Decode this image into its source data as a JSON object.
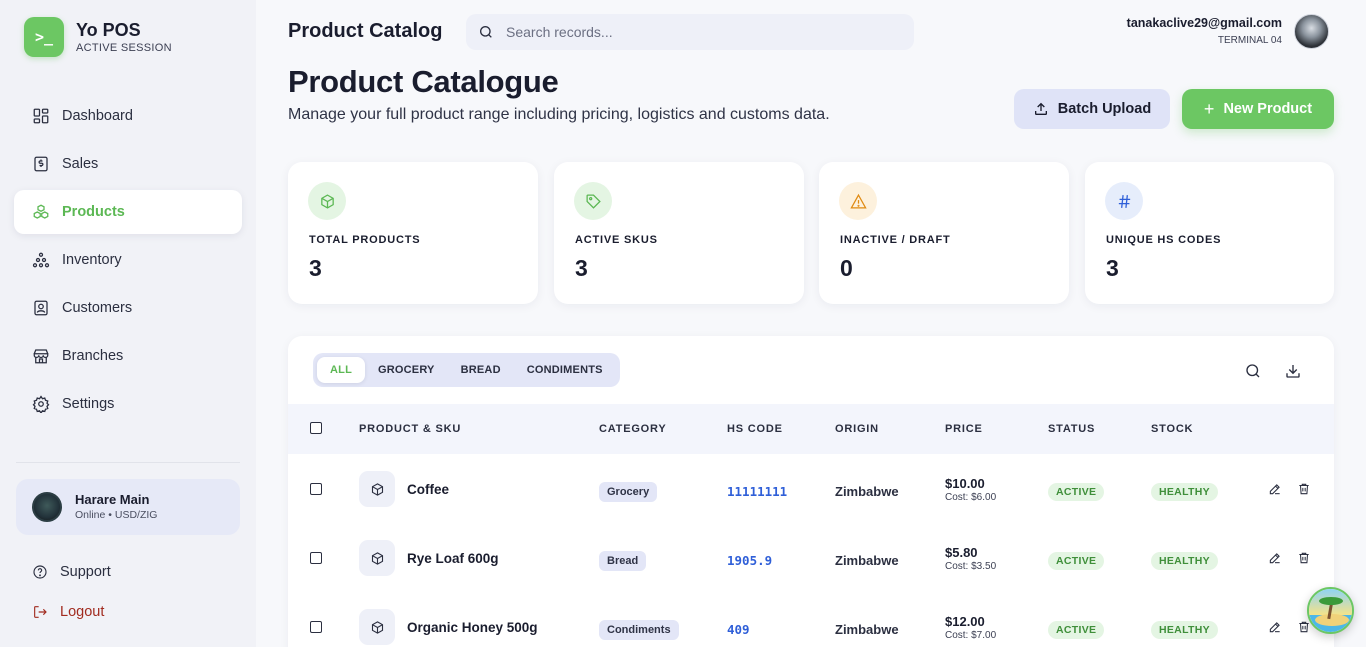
{
  "brand": {
    "logo_glyph": ">_",
    "name": "Yo POS",
    "subtitle": "ACTIVE SESSION"
  },
  "sidebar": {
    "items": [
      {
        "label": "Dashboard",
        "icon": "dashboard-icon",
        "active": false
      },
      {
        "label": "Sales",
        "icon": "receipt-icon",
        "active": false
      },
      {
        "label": "Products",
        "icon": "boxes-icon",
        "active": true
      },
      {
        "label": "Inventory",
        "icon": "inventory-icon",
        "active": false
      },
      {
        "label": "Customers",
        "icon": "contact-card-icon",
        "active": false
      },
      {
        "label": "Branches",
        "icon": "store-icon",
        "active": false
      },
      {
        "label": "Settings",
        "icon": "gear-icon",
        "active": false
      }
    ],
    "branch": {
      "name": "Harare Main",
      "status": "Online • USD/ZIG"
    },
    "support_label": "Support",
    "logout_label": "Logout"
  },
  "header": {
    "title": "Product Catalog",
    "search_placeholder": "Search records...",
    "user_email": "tanakaclive29@gmail.com",
    "terminal": "TERMINAL 04"
  },
  "page": {
    "title": "Product Catalogue",
    "subtitle": "Manage your full product range including pricing, logistics and customs data.",
    "batch_upload_label": "Batch Upload",
    "new_product_label": "New Product"
  },
  "stats": [
    {
      "label": "TOTAL PRODUCTS",
      "value": "3",
      "icon": "cube-icon",
      "color": "#5cb854",
      "bg": "#e4f5e3"
    },
    {
      "label": "ACTIVE SKUS",
      "value": "3",
      "icon": "tag-icon",
      "color": "#5cb854",
      "bg": "#e4f5e3"
    },
    {
      "label": "INACTIVE / DRAFT",
      "value": "0",
      "icon": "warning-icon",
      "color": "#e08a12",
      "bg": "#fdf1dd"
    },
    {
      "label": "UNIQUE HS CODES",
      "value": "3",
      "icon": "hash-icon",
      "color": "#2f5fd8",
      "bg": "#e6edfb"
    }
  ],
  "filters": {
    "tabs": [
      "ALL",
      "GROCERY",
      "BREAD",
      "CONDIMENTS"
    ],
    "active": "ALL"
  },
  "table": {
    "columns": [
      "PRODUCT & SKU",
      "CATEGORY",
      "HS CODE",
      "ORIGIN",
      "PRICE",
      "STATUS",
      "STOCK"
    ],
    "rows": [
      {
        "name": "Coffee",
        "category": "Grocery",
        "hs_code": "11111111",
        "origin": "Zimbabwe",
        "price": "$10.00",
        "cost": "Cost: $6.00",
        "status": "ACTIVE",
        "stock": "HEALTHY"
      },
      {
        "name": "Rye Loaf 600g",
        "category": "Bread",
        "hs_code": "1905.9",
        "origin": "Zimbabwe",
        "price": "$5.80",
        "cost": "Cost: $3.50",
        "status": "ACTIVE",
        "stock": "HEALTHY"
      },
      {
        "name": "Organic Honey 500g",
        "category": "Condiments",
        "hs_code": "409",
        "origin": "Zimbabwe",
        "price": "$12.00",
        "cost": "Cost: $7.00",
        "status": "ACTIVE",
        "stock": "HEALTHY"
      }
    ]
  }
}
